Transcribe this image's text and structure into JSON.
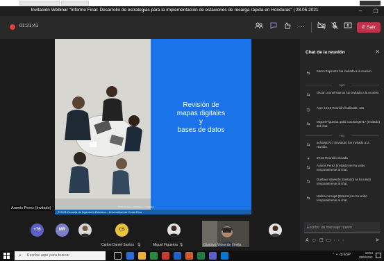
{
  "window": {
    "title": "Invitación Webinar \"Informe Final: Desarrollo de estrategias para la implementación de estaciones de recarga rápida en Honduras\" | 28.05.2021"
  },
  "toolbar": {
    "timer": "01:21:41",
    "leave_label": "Salir"
  },
  "slide": {
    "title_lines": [
      "Revisión de",
      "mapas digitales",
      "y",
      "bases de datos"
    ],
    "footer": "© 2021 Escuela de Ingeniería Eléctrica – Universidad de Costa Rica",
    "credit": "Photo by Jason Goodman on Unsplash"
  },
  "presenter": {
    "name": "Aramis Perez (Invitado)"
  },
  "participants": {
    "overflow": "+76",
    "initials_1": "MR",
    "initials_2": "CS",
    "name_1": "Carlos Daniel Santos",
    "name_2": "Miguel Figueroa",
    "name_3": "Gustavo Valverde (Invita"
  },
  "chat": {
    "title": "Chat de la reunión",
    "events_1": [
      {
        "icon": "join-icon",
        "text": "Karen Espinoza fue invitado a la reunión."
      }
    ],
    "day_1": "Ayer",
    "events_2": [
      {
        "icon": "join-icon",
        "text": "Oscar Leonel Ramos fue invitado a la reunión."
      },
      {
        "icon": "clock-icon",
        "text": "Ayer 16:18  Reunión finalizada: 13s"
      },
      {
        "icon": "leave-icon",
        "text": "Miguel Figueroa quitó a achang0717 (Invitado) del chat."
      }
    ],
    "day_2": "Hoy",
    "events_3": [
      {
        "icon": "join-icon",
        "text": "achang0717 (Invitado) fue invitado a la reunión."
      },
      {
        "icon": "meeting-icon",
        "text": "09:33  Reunión iniciada"
      },
      {
        "icon": "join-icon",
        "text": "Aramis Perez (Invitado) se ha unido temporalmente al chat."
      },
      {
        "icon": "join-icon",
        "text": "Gustavo Valverde (Invitado) se ha unido temporalmente al chat."
      },
      {
        "icon": "join-icon",
        "text": "Molina Arreaga (Externo) se ha unido temporalmente al chat."
      }
    ],
    "input_placeholder": "Escribir un mensaje nuevo"
  },
  "taskbar": {
    "search_placeholder": "Escribe aquí para buscar",
    "lang": "ESP",
    "time": "10:54",
    "date": "28/5/2021"
  },
  "colors": {
    "accent": "#6264a7",
    "leave": "#c4314b",
    "slide_blue": "#1a73e8",
    "avatar_plus": "#5b5fc7",
    "avatar_mr": "#7a7fc7",
    "avatar_cs": "#e8c53c"
  }
}
